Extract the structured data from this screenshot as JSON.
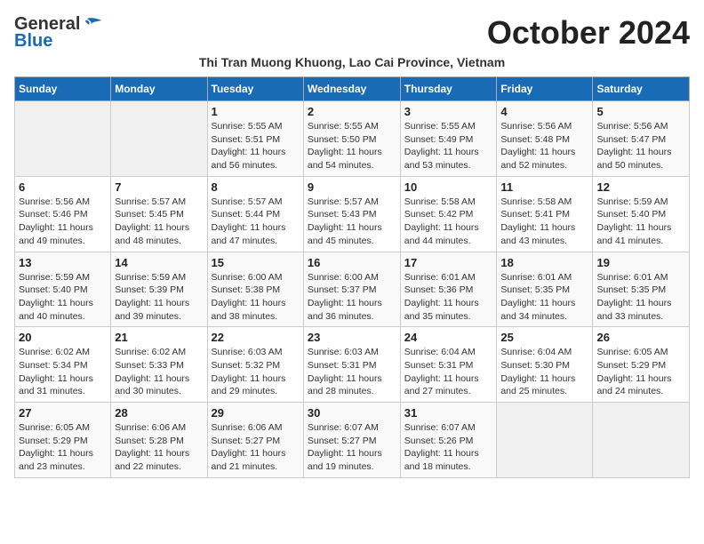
{
  "logo": {
    "line1": "General",
    "line2": "Blue"
  },
  "header": {
    "title": "October 2024",
    "subtitle": "Thi Tran Muong Khuong, Lao Cai Province, Vietnam"
  },
  "weekdays": [
    "Sunday",
    "Monday",
    "Tuesday",
    "Wednesday",
    "Thursday",
    "Friday",
    "Saturday"
  ],
  "weeks": [
    [
      {
        "day": "",
        "info": ""
      },
      {
        "day": "",
        "info": ""
      },
      {
        "day": "1",
        "info": "Sunrise: 5:55 AM\nSunset: 5:51 PM\nDaylight: 11 hours and 56 minutes."
      },
      {
        "day": "2",
        "info": "Sunrise: 5:55 AM\nSunset: 5:50 PM\nDaylight: 11 hours and 54 minutes."
      },
      {
        "day": "3",
        "info": "Sunrise: 5:55 AM\nSunset: 5:49 PM\nDaylight: 11 hours and 53 minutes."
      },
      {
        "day": "4",
        "info": "Sunrise: 5:56 AM\nSunset: 5:48 PM\nDaylight: 11 hours and 52 minutes."
      },
      {
        "day": "5",
        "info": "Sunrise: 5:56 AM\nSunset: 5:47 PM\nDaylight: 11 hours and 50 minutes."
      }
    ],
    [
      {
        "day": "6",
        "info": "Sunrise: 5:56 AM\nSunset: 5:46 PM\nDaylight: 11 hours and 49 minutes."
      },
      {
        "day": "7",
        "info": "Sunrise: 5:57 AM\nSunset: 5:45 PM\nDaylight: 11 hours and 48 minutes."
      },
      {
        "day": "8",
        "info": "Sunrise: 5:57 AM\nSunset: 5:44 PM\nDaylight: 11 hours and 47 minutes."
      },
      {
        "day": "9",
        "info": "Sunrise: 5:57 AM\nSunset: 5:43 PM\nDaylight: 11 hours and 45 minutes."
      },
      {
        "day": "10",
        "info": "Sunrise: 5:58 AM\nSunset: 5:42 PM\nDaylight: 11 hours and 44 minutes."
      },
      {
        "day": "11",
        "info": "Sunrise: 5:58 AM\nSunset: 5:41 PM\nDaylight: 11 hours and 43 minutes."
      },
      {
        "day": "12",
        "info": "Sunrise: 5:59 AM\nSunset: 5:40 PM\nDaylight: 11 hours and 41 minutes."
      }
    ],
    [
      {
        "day": "13",
        "info": "Sunrise: 5:59 AM\nSunset: 5:40 PM\nDaylight: 11 hours and 40 minutes."
      },
      {
        "day": "14",
        "info": "Sunrise: 5:59 AM\nSunset: 5:39 PM\nDaylight: 11 hours and 39 minutes."
      },
      {
        "day": "15",
        "info": "Sunrise: 6:00 AM\nSunset: 5:38 PM\nDaylight: 11 hours and 38 minutes."
      },
      {
        "day": "16",
        "info": "Sunrise: 6:00 AM\nSunset: 5:37 PM\nDaylight: 11 hours and 36 minutes."
      },
      {
        "day": "17",
        "info": "Sunrise: 6:01 AM\nSunset: 5:36 PM\nDaylight: 11 hours and 35 minutes."
      },
      {
        "day": "18",
        "info": "Sunrise: 6:01 AM\nSunset: 5:35 PM\nDaylight: 11 hours and 34 minutes."
      },
      {
        "day": "19",
        "info": "Sunrise: 6:01 AM\nSunset: 5:35 PM\nDaylight: 11 hours and 33 minutes."
      }
    ],
    [
      {
        "day": "20",
        "info": "Sunrise: 6:02 AM\nSunset: 5:34 PM\nDaylight: 11 hours and 31 minutes."
      },
      {
        "day": "21",
        "info": "Sunrise: 6:02 AM\nSunset: 5:33 PM\nDaylight: 11 hours and 30 minutes."
      },
      {
        "day": "22",
        "info": "Sunrise: 6:03 AM\nSunset: 5:32 PM\nDaylight: 11 hours and 29 minutes."
      },
      {
        "day": "23",
        "info": "Sunrise: 6:03 AM\nSunset: 5:31 PM\nDaylight: 11 hours and 28 minutes."
      },
      {
        "day": "24",
        "info": "Sunrise: 6:04 AM\nSunset: 5:31 PM\nDaylight: 11 hours and 27 minutes."
      },
      {
        "day": "25",
        "info": "Sunrise: 6:04 AM\nSunset: 5:30 PM\nDaylight: 11 hours and 25 minutes."
      },
      {
        "day": "26",
        "info": "Sunrise: 6:05 AM\nSunset: 5:29 PM\nDaylight: 11 hours and 24 minutes."
      }
    ],
    [
      {
        "day": "27",
        "info": "Sunrise: 6:05 AM\nSunset: 5:29 PM\nDaylight: 11 hours and 23 minutes."
      },
      {
        "day": "28",
        "info": "Sunrise: 6:06 AM\nSunset: 5:28 PM\nDaylight: 11 hours and 22 minutes."
      },
      {
        "day": "29",
        "info": "Sunrise: 6:06 AM\nSunset: 5:27 PM\nDaylight: 11 hours and 21 minutes."
      },
      {
        "day": "30",
        "info": "Sunrise: 6:07 AM\nSunset: 5:27 PM\nDaylight: 11 hours and 19 minutes."
      },
      {
        "day": "31",
        "info": "Sunrise: 6:07 AM\nSunset: 5:26 PM\nDaylight: 11 hours and 18 minutes."
      },
      {
        "day": "",
        "info": ""
      },
      {
        "day": "",
        "info": ""
      }
    ]
  ]
}
